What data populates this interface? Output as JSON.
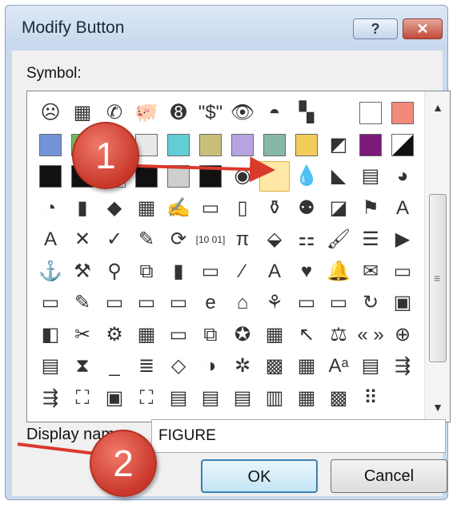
{
  "dialog": {
    "title": "Modify Button",
    "help_button": "?",
    "close_button": "✕"
  },
  "symbol_label": "Symbol:",
  "icons": [
    "☹",
    "▦",
    "✆",
    "🐖",
    "➑",
    "\"$\"",
    "👁",
    "◓",
    "▚",
    "",
    "",
    "",
    "",
    "",
    "",
    "",
    "",
    "",
    "",
    "",
    "",
    "◩",
    "",
    "",
    "",
    "",
    "",
    "",
    "",
    "",
    "◉",
    "",
    "💧",
    "◣",
    "▤",
    "◕",
    "◔",
    "▮",
    "◆",
    "▦",
    "✍",
    "▭",
    "▯",
    "⚱",
    "⚉",
    "◪",
    "⚑",
    "A",
    "A",
    "✕",
    "✓",
    "✎",
    "⟳",
    "[10 01]",
    "π",
    "⬙",
    "⚏",
    "🖌",
    "☰",
    "▶",
    "⚓",
    "⚒",
    "⚲",
    "⧉",
    "▮",
    "▭",
    "∕",
    "A",
    "♥",
    "🔔",
    "✉",
    "▭",
    "▭",
    "✎",
    "▭",
    "▭",
    "▭",
    "e",
    "⌂",
    "⚘",
    "▭",
    "▭",
    "↻",
    "▣",
    "◧",
    "✂",
    "⚙",
    "▦",
    "▭",
    "⧉",
    "✪",
    "▦",
    "↖",
    "⚖",
    "« »",
    "⊕",
    "▤",
    "⧗",
    "_",
    "≣",
    "◇",
    "◑",
    "✲",
    "▩",
    "▦",
    "Aᵃ",
    "▤",
    "⇶",
    "⇶",
    "⛶",
    "▣",
    "⛶",
    "▤",
    "▤",
    "▤",
    "▥",
    "▦",
    "▩",
    "⠿"
  ],
  "colors": {
    "accent_blue": "#3c7fb1",
    "callout_red": "#c8382a",
    "close_red": "#c2493a",
    "selection": "#ffe8a6"
  },
  "scrollbar": {
    "up": "▲",
    "down": "▼",
    "grip": "≡"
  },
  "display_name": {
    "label": "Display name:",
    "value": "FIGURE"
  },
  "buttons": {
    "ok": "OK",
    "cancel": "Cancel"
  },
  "annotations": {
    "callout_1": "1",
    "callout_2": "2"
  }
}
